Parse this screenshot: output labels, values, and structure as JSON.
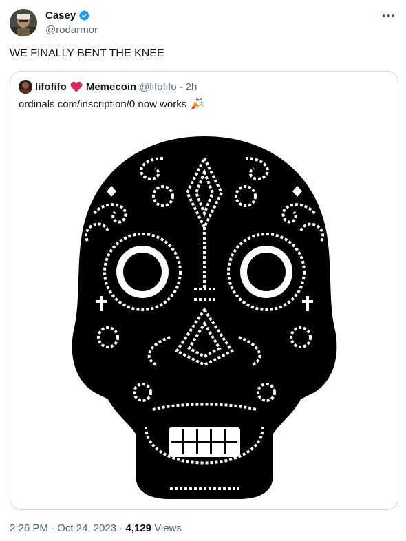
{
  "author": {
    "name": "Casey",
    "handle": "@rodarmor",
    "verified": true,
    "avatar_icon": "avatar-photo"
  },
  "tweet": {
    "text": "WE FINALLY BENT THE KNEE"
  },
  "quoted": {
    "name_part1": "lifofifo",
    "name_part2": "Memecoin",
    "handle": "@lifofifo",
    "separator": "·",
    "time": "2h",
    "text": "ordinals.com/inscription/0 now works",
    "emoji_icon": "party-popper-icon",
    "image_icon": "sugar-skull-pixel-art"
  },
  "footer": {
    "time": "2:26 PM",
    "sep1": "·",
    "date": "Oct 24, 2023",
    "sep2": "·",
    "views_count": "4,129",
    "views_label": "Views"
  },
  "colors": {
    "text": "#0f1419",
    "muted": "#536471",
    "border": "#cfd9de",
    "verified_blue": "#1d9bf0",
    "heart_red": "#e0245e",
    "skull": "#000000"
  }
}
